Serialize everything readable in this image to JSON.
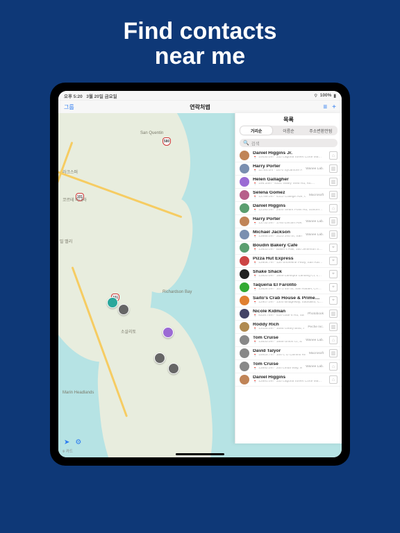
{
  "hero": {
    "line1": "Find contacts",
    "line2": "near me"
  },
  "status": {
    "time": "오후 5:20",
    "date": "3월 20일 금요일",
    "battery": "100%"
  },
  "nav": {
    "left": "그룹",
    "title": "연락처맵",
    "btn_list": "≡",
    "btn_add": "+"
  },
  "panel": {
    "title": "목록",
    "segments": [
      "거리순",
      "이름순",
      "주소변환안됨"
    ],
    "selected_segment": 0,
    "search_placeholder": "검색"
  },
  "map": {
    "credit": "카드",
    "labels": {
      "san_quentin": "San Quentin",
      "larkspur": "라크스퍼",
      "corte_madera": "코르테 마데라",
      "mill_valley": "밀 밸리",
      "richardson_bay": "Richardson Bay",
      "sausalito": "소살리토",
      "marin_headlands": "Marin Headlands"
    },
    "shields": [
      "101",
      "101",
      "580"
    ]
  },
  "contacts": [
    {
      "name": "Daniel Higgins Jr.",
      "sub": "10030.0m · 332 Laguna Street Corte Ma…",
      "org": "",
      "kind": "home"
    },
    {
      "name": "Harry Porter",
      "sub": "11764.0m · 1570 Sycamore Ave #7500…",
      "org": "Wanee Lab.",
      "kind": "work"
    },
    {
      "name": "Helen Gallagher",
      "sub": "196.34m · 5321 Valley View Rd, Ric…",
      "org": "",
      "kind": "work"
    },
    {
      "name": "Selena Gomez",
      "sub": "12789.0m · 4312 College Ave, Oakland…",
      "org": "Macrosoft",
      "kind": "work"
    },
    {
      "name": "Daniel Higgins",
      "sub": "12193.0m · 2400 Sears Point Rd, Sonom…",
      "org": "",
      "kind": "home"
    },
    {
      "name": "Harry Porter",
      "sub": "13732.0m · 1760 Lincoln Ave, Alameda…",
      "org": "Wanee Lab.",
      "kind": "work"
    },
    {
      "name": "Michael Jackson",
      "sub": "13855.0m · 3123 2nd St, San Francisco…",
      "org": "Wanee Lab.",
      "kind": "work"
    },
    {
      "name": "Boudin Bakery Cafe",
      "sub": "13633.0m · Baker's Hall, 160 Jefferson S…",
      "org": "",
      "kind": "place"
    },
    {
      "name": "Pizza Hut Express",
      "sub": "12606.7m · 120 Shoreline Pkwy, San Raf…",
      "org": "",
      "kind": "place"
    },
    {
      "name": "Shake Shack",
      "sub": "13820.0m · 1849 Larkspur Landing Cr, L…",
      "org": "",
      "kind": "place"
    },
    {
      "name": "Taqueria El Farolito",
      "sub": "13628.0m · 1071 4th St, San Rafael, CA…",
      "org": "",
      "kind": "place"
    },
    {
      "name": "Saito's Crab House & Prime…",
      "sub": "12907.0m · 1300 Bridgeway, Sausalito, C…",
      "org": "",
      "kind": "place"
    },
    {
      "name": "Nicole Kidman",
      "sub": "8328.75m · 415 Gate 6 Rd, Sausalito, CA 949…",
      "org": "Photobook",
      "kind": "work"
    },
    {
      "name": "Roddy Rich",
      "sub": "13125.0m · 1085 Geary Blvd, San Fran…",
      "org": "Peche Inc.",
      "kind": "work"
    },
    {
      "name": "Tom Cruise",
      "sub": "13833.0m · 1859 Union Ct, Sausalito, CA 949…",
      "org": "Wanee Lab.",
      "kind": "home"
    },
    {
      "name": "David Talyor",
      "sub": "15915.7m · 105 C D Camino Real, Millbra…",
      "org": "Macrosoft",
      "kind": "work"
    },
    {
      "name": "Tom Cruise",
      "sub": "13892.0m · 200 Linda Way, Mill Valley, C…",
      "org": "Wanee Lab.",
      "kind": "home"
    },
    {
      "name": "Daniel Higgins",
      "sub": "12891.0m · 332 Laguna Street Corte Ma…",
      "org": "",
      "kind": "home"
    }
  ]
}
